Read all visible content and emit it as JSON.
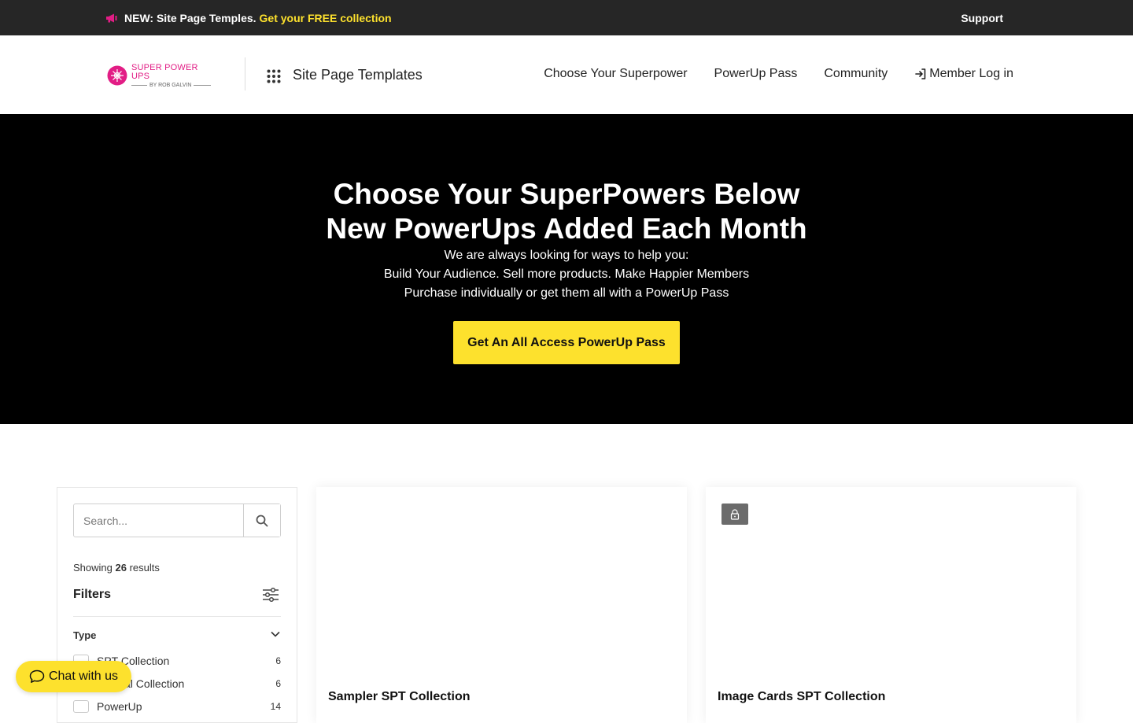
{
  "announcement": {
    "text": "NEW: Site Page Temples.",
    "link_text": "Get your FREE collection",
    "support_label": "Support"
  },
  "header": {
    "logo_line1": "SUPER POWER UPS",
    "logo_line2": "BY ROB GALVIN",
    "site_title": "Site Page Templates",
    "nav": [
      {
        "label": "Choose Your Superpower"
      },
      {
        "label": "PowerUp Pass"
      },
      {
        "label": "Community"
      },
      {
        "label": "Member Log in"
      }
    ]
  },
  "hero": {
    "title_line1": "Choose Your SuperPowers Below",
    "title_line2": "New PowerUps Added Each Month",
    "sub_lines": [
      "We are always looking for ways to help you:",
      "Build Your Audience. Sell more products. Make Happier Members",
      "Purchase individually or get them all with a PowerUp Pass"
    ],
    "cta_label": "Get An All Access PowerUp Pass"
  },
  "sidebar": {
    "search_placeholder": "Search...",
    "showing_prefix": "Showing",
    "results_count": "26",
    "showing_suffix": "results",
    "filters_title": "Filters",
    "type_label": "Type",
    "type_options": [
      {
        "label": "SPT Collection",
        "count": "6"
      },
      {
        "label": "Special Collection",
        "count": "6"
      },
      {
        "label": "PowerUp",
        "count": "14"
      }
    ]
  },
  "products": [
    {
      "title": "Sampler SPT Collection",
      "locked": false
    },
    {
      "title": "Image Cards SPT Collection",
      "locked": true
    }
  ],
  "chat": {
    "label": "Chat with us"
  },
  "colors": {
    "accent_yellow": "#fde12d",
    "brand_pink": "#e21d85",
    "topbar_bg": "#262626",
    "hero_bg": "#000000"
  }
}
